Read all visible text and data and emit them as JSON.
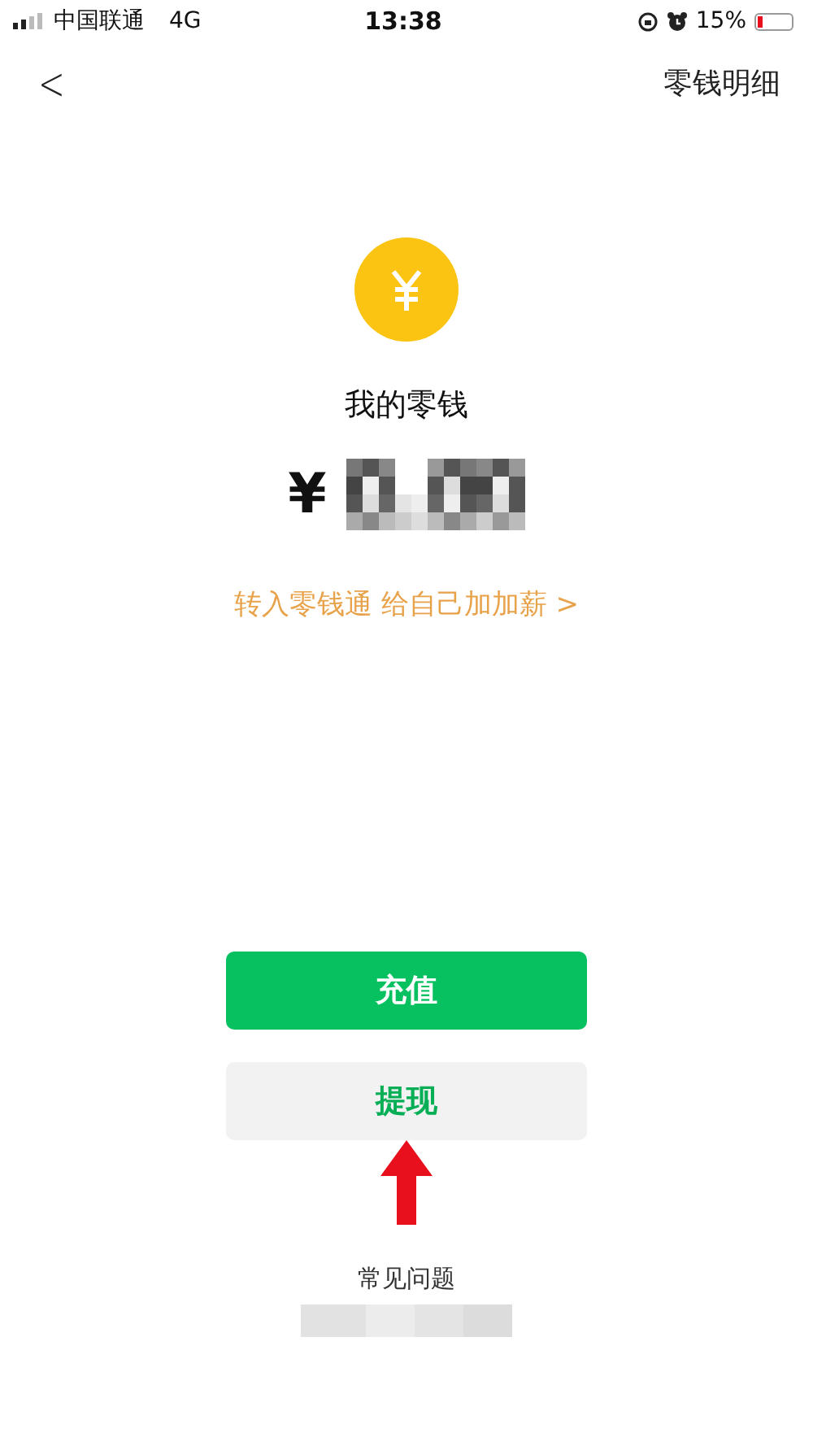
{
  "status_bar": {
    "carrier": "中国联通",
    "network": "4G",
    "time": "13:38",
    "battery_text": "15%",
    "battery": {
      "level": 0.15
    }
  },
  "nav": {
    "back": "<",
    "right_link": "零钱明细"
  },
  "wallet": {
    "title": "我的零钱",
    "currency": "¥",
    "promo": "转入零钱通 给自己加加薪",
    "promo_arrow": ">"
  },
  "buttons": [
    {
      "label": "充值",
      "kind": "primary"
    },
    {
      "label": "提现",
      "kind": "secondary"
    }
  ],
  "footer": {
    "faq": "常见问题"
  }
}
